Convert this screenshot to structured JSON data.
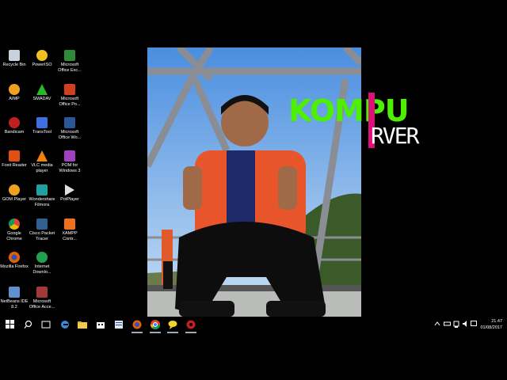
{
  "desktop": {
    "icons": [
      {
        "label": "Recycle Bin",
        "icon": "recycle-bin-icon",
        "color": "#c8d2dc"
      },
      {
        "label": "PowerISO",
        "icon": "poweriso-icon",
        "color": "#f0c020"
      },
      {
        "label": "Microsoft Office Exc...",
        "icon": "excel-icon",
        "color": "#2e8b3a"
      },
      {
        "label": "AIMP",
        "icon": "aimp-icon",
        "color": "#f0a020"
      },
      {
        "label": "SMADAV",
        "icon": "smadav-icon",
        "color": "#28b828"
      },
      {
        "label": "Microsoft Office Po...",
        "icon": "powerpoint-icon",
        "color": "#d04020"
      },
      {
        "label": "Bandicam",
        "icon": "bandicam-icon",
        "color": "#c02020"
      },
      {
        "label": "TransTool",
        "icon": "transtool-icon",
        "color": "#4070e0"
      },
      {
        "label": "Microsoft Office Wo...",
        "icon": "word-icon",
        "color": "#2b579a"
      },
      {
        "label": "Foxit Reader",
        "icon": "foxit-reader-icon",
        "color": "#e05010"
      },
      {
        "label": "VLC media player",
        "icon": "vlc-icon",
        "color": "#f08010"
      },
      {
        "label": "POM for Windows 3",
        "icon": "pom-icon",
        "color": "#a040c0"
      },
      {
        "label": "GOM Player",
        "icon": "gom-player-icon",
        "color": "#f0a020"
      },
      {
        "label": "Wondershare Filmora",
        "icon": "filmora-icon",
        "color": "#20a0a0"
      },
      {
        "label": "PotPlayer",
        "icon": "potplayer-icon",
        "color": "#e0e0e0"
      },
      {
        "label": "Google Chrome",
        "icon": "chrome-icon",
        "color": "#db4437"
      },
      {
        "label": "Cisco Packet Tracer",
        "icon": "packet-tracer-icon",
        "color": "#306090"
      },
      {
        "label": "XAMPP Contr...",
        "icon": "xampp-icon",
        "color": "#f07020"
      },
      {
        "label": "Mozilla Firefox",
        "icon": "firefox-icon",
        "color": "#e66000"
      },
      {
        "label": "Internet Downlo...",
        "icon": "internet-download-manager-icon",
        "color": "#20a050"
      },
      {
        "label": "NetBeans IDE 8.2",
        "icon": "netbeans-icon",
        "color": "#6090d0"
      },
      {
        "label": "Microsoft Office Acce...",
        "icon": "access-icon",
        "color": "#a4373a"
      }
    ]
  },
  "overlay": {
    "text1": "KOMPU",
    "text2": "RVER",
    "accent": "#4cf000",
    "bar_color": "#e0107a"
  },
  "taskbar": {
    "start_icon": "windows-start-icon",
    "search_icon": "search-icon",
    "task_view_icon": "task-view-icon",
    "apps": [
      "edge-icon",
      "file-explorer-icon",
      "store-icon",
      "word-icon",
      "firefox-icon",
      "chrome-icon",
      "chat-icon",
      "bandicam-icon"
    ],
    "tray_icons": [
      "chevron-up-icon",
      "network-icon",
      "volume-icon",
      "notification-icon"
    ],
    "time": "21.47",
    "date": "01/08/2017"
  }
}
